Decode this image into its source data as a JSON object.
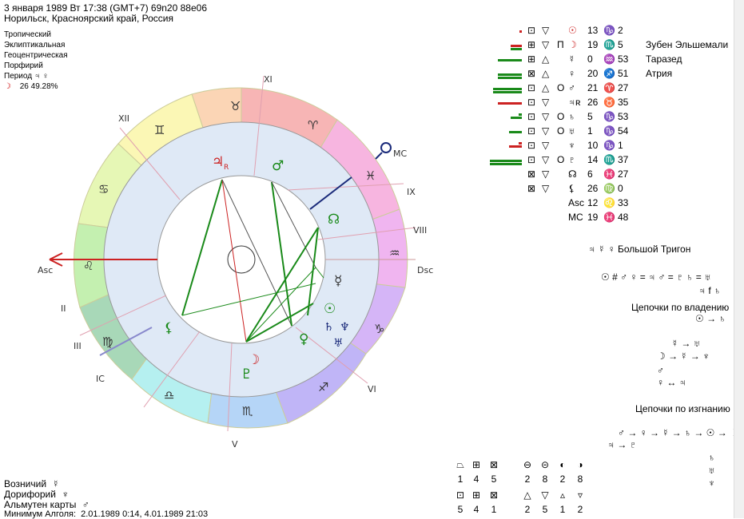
{
  "header": {
    "line1": "3 января 1989  Вт  17:38 (GMT+7) 69n20  88e06",
    "line2": "Норильск, Красноярский край, Россия"
  },
  "settings": {
    "zodiac": "Тропический",
    "coords": "Эклиптикальная",
    "center": "Геоцентрическая",
    "houses": "Порфирий",
    "period_label": "Период",
    "period_value": "♃ ♀",
    "moon_line": "26 49.28%"
  },
  "chart": {
    "asc_label": "Asc",
    "dsc_label": "Dsc",
    "mc_label": "MC",
    "ic_label": "IC",
    "houses": [
      "I",
      "II",
      "III",
      "IV",
      "V",
      "VI",
      "VII",
      "VIII",
      "IX",
      "X",
      "XI",
      "XII"
    ],
    "house_labels_shown": [
      "II",
      "III",
      "V",
      "VI",
      "VIII",
      "IX",
      "XI",
      "XII"
    ],
    "retro_mark": "R"
  },
  "planet_table": [
    {
      "glyph": "☉",
      "deg": "13",
      "sign": "♑",
      "min": "2",
      "star": ""
    },
    {
      "glyph": "☽",
      "deg": "19",
      "sign": "♏",
      "min": "5",
      "star": "Зубен Эльшемали"
    },
    {
      "glyph": "☿",
      "deg": "0",
      "sign": "♒",
      "min": "53",
      "star": "Таразед"
    },
    {
      "glyph": "♀",
      "deg": "20",
      "sign": "♐",
      "min": "51",
      "star": "Атрия"
    },
    {
      "glyph": "♂",
      "deg": "21",
      "sign": "♈",
      "min": "27",
      "star": ""
    },
    {
      "glyph": "♃ʀ",
      "deg": "26",
      "sign": "♉",
      "min": "35",
      "star": ""
    },
    {
      "glyph": "♄",
      "deg": "5",
      "sign": "♑",
      "min": "53",
      "star": ""
    },
    {
      "glyph": "♅",
      "deg": "1",
      "sign": "♑",
      "min": "54",
      "star": ""
    },
    {
      "glyph": "♆",
      "deg": "10",
      "sign": "♑",
      "min": "1",
      "star": ""
    },
    {
      "glyph": "♇",
      "deg": "14",
      "sign": "♏",
      "min": "37",
      "star": ""
    },
    {
      "glyph": "☊",
      "deg": "6",
      "sign": "♓",
      "min": "27",
      "star": ""
    },
    {
      "glyph": "⚸",
      "deg": "26",
      "sign": "♍",
      "min": "0",
      "star": ""
    },
    {
      "glyph": "Asc",
      "deg": "12",
      "sign": "♌",
      "min": "33",
      "star": ""
    },
    {
      "glyph": "MC",
      "deg": "19",
      "sign": "♓",
      "min": "48",
      "star": ""
    }
  ],
  "right_panel": {
    "trigon": "♃ ☿ ♀  Большой Тригон",
    "formula1": "☉ # ♂ ♀ = ♃  ♂ = ♇ ♄ = ♅",
    "formula2": "♃ f ♄",
    "chains_ownership": "Цепочки по владению",
    "chains_exile": "Цепочки по изгнанию",
    "own_rows": [
      "☉ → ♄",
      "☿ → ♅",
      "☽ → ☿ → ♆",
      "♂",
      "♀ ↔ ♃"
    ],
    "exile_rows": [
      "♂ → ♀ → ☿ → ♄ → ☉ → ☽",
      "♃ → ♇",
      "♄",
      "♅",
      "♆"
    ]
  },
  "bottom_left": {
    "charioteer_label": "Возничий",
    "charioteer_value": "☿",
    "doryphory_label": "Дорифорий",
    "doryphory_value": "♆",
    "almuten_label": "Альмутен карты",
    "almuten_value": "♂",
    "algol_label": "Минимум Алголя:",
    "algol_value": "2.01.1989  0:14,  4.01.1989 21:03"
  },
  "bottom_stats": {
    "row1_counts": [
      "1",
      "4",
      "5",
      "2",
      "8",
      "2",
      "8"
    ],
    "row2_counts": [
      "5",
      "4",
      "1",
      "2",
      "5",
      "1",
      "2"
    ]
  },
  "colors": {
    "green_aspect": "#1a8a1a",
    "red_aspect": "#cc2222",
    "blue_axis": "#1a2a7a",
    "ring_bg": "#dfe9f6"
  }
}
